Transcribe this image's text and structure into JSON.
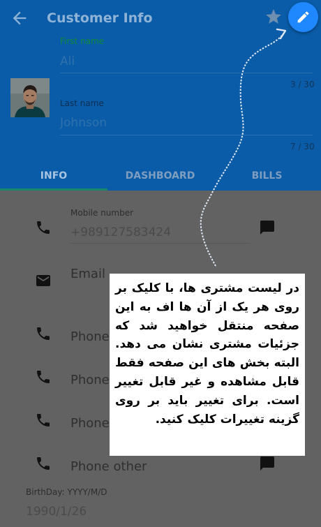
{
  "toolbar": {
    "title": "Customer Info",
    "back_icon": "arrow-back-icon",
    "star_icon": "star-icon",
    "edit_icon": "pencil-edit-icon"
  },
  "profile": {
    "first_name_label": "First name",
    "first_name_value": "Ali",
    "first_name_counter": "3 / 30",
    "last_name_label": "Last name",
    "last_name_value": "Johnson",
    "last_name_counter": "7 / 30"
  },
  "tabs": [
    {
      "label": "INFO",
      "active": true
    },
    {
      "label": "DASHBOARD",
      "active": false
    },
    {
      "label": "BILLS",
      "active": false
    }
  ],
  "fields": {
    "mobile_label": "Mobile number",
    "mobile_value": "+989127583424",
    "email_label": "Email",
    "phone_rows": [
      "Phone",
      "Phone",
      "Phone",
      "Phone other"
    ],
    "birthday_label": "BirthDay: YYYY/M/D",
    "birthday_value": "1990/1/26"
  },
  "tutorial": {
    "text": "در لیست مشتری ها، با کلیک بر روی هر یک از آن ها اف به این صفحه منتقل خواهید شد که جزئیات مشتری نشان می دهد. البته بخش های این صفحه فقط قابل مشاهده و غیر قابل تغییر است. برای تغییر باید بر روی گزینه تغییرات کلیک کنید."
  },
  "colors": {
    "header": "#0a5ca8",
    "fab": "#1f88ff",
    "dim_overlay": "#626262",
    "tab_indicator": "#17896a"
  }
}
